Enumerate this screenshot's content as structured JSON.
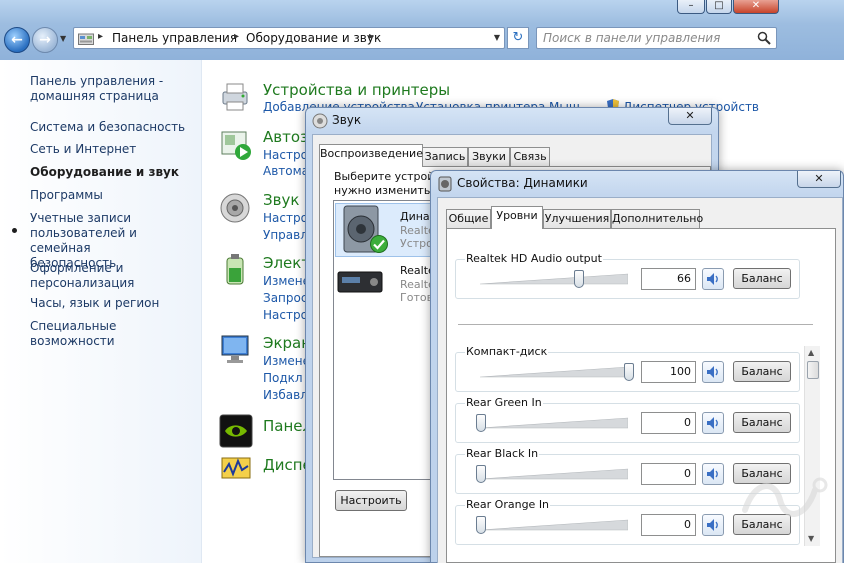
{
  "explorer": {
    "address_crumbs": [
      "Панель управления",
      "Оборудование и звук"
    ],
    "search_placeholder": "Поиск в панели управления",
    "sidebar": {
      "items": [
        "Панель управления -\nдомашняя страница",
        "Система и безопасность",
        "Сеть и Интернет",
        "Оборудование и звук",
        "Программы",
        "Учетные записи\nпользователей и семейная\nбезопасность",
        "Оформление и\nперсонализация",
        "Часы, язык и регион",
        "Специальные возможности"
      ],
      "active_index": 3
    },
    "categories": [
      {
        "title": "Устройства и принтеры",
        "icon": "printer-icon",
        "links": [
          "Добавление устройства",
          "Установка принтера",
          "Мыш",
          "Диспетчер устройств"
        ]
      },
      {
        "title": "Автоз",
        "icon": "autoplay-icon",
        "links": [
          "Настро",
          "Автома"
        ]
      },
      {
        "title": "Звук",
        "icon": "speaker-icon",
        "links": [
          "Настро",
          "Управл"
        ]
      },
      {
        "title": "Элект",
        "icon": "battery-icon",
        "links": [
          "Измене",
          "Запрос",
          "Настро"
        ]
      },
      {
        "title": "Экран",
        "icon": "monitor-icon",
        "links": [
          "Измене",
          "Подкл",
          "Избавл"
        ]
      },
      {
        "title": "Панел",
        "icon": "nvidia-icon",
        "links": []
      },
      {
        "title": "Диспе",
        "icon": "dispatcher-icon",
        "links": []
      }
    ]
  },
  "sound_dialog": {
    "title": "Звук",
    "tabs": [
      "Воспроизведение",
      "Запись",
      "Звуки",
      "Связь"
    ],
    "selected_tab": 0,
    "prompt_line1": "Выберите устрой",
    "prompt_line2": "нужно изменить:",
    "devices": [
      {
        "name": "Динам",
        "line2": "Realte",
        "line3": "Устро",
        "icon": "speaker-device-icon",
        "default": true
      },
      {
        "name": "Realte",
        "line2": "Realte",
        "line3": "Готов",
        "icon": "digital-output-icon",
        "default": false
      }
    ],
    "configure_button": "Настроить"
  },
  "props_dialog": {
    "title": "Свойства: Динамики",
    "close_label": "✕",
    "tabs": [
      "Общие",
      "Уровни",
      "Улучшения",
      "Дополнительно"
    ],
    "selected_tab": 1,
    "balance_label": "Баланс",
    "master": {
      "name": "Realtek HD Audio output",
      "value": "66",
      "level": 66
    },
    "channels": [
      {
        "name": "Компакт-диск",
        "value": "100",
        "level": 100
      },
      {
        "name": "Rear Green In",
        "value": "0",
        "level": 0
      },
      {
        "name": "Rear Black In",
        "value": "0",
        "level": 0
      },
      {
        "name": "Rear Orange In",
        "value": "0",
        "level": 0
      }
    ]
  },
  "colors": {
    "link": "#1d58a8",
    "category_title": "#1f7a1f",
    "titlebar": "#9dbde0"
  }
}
